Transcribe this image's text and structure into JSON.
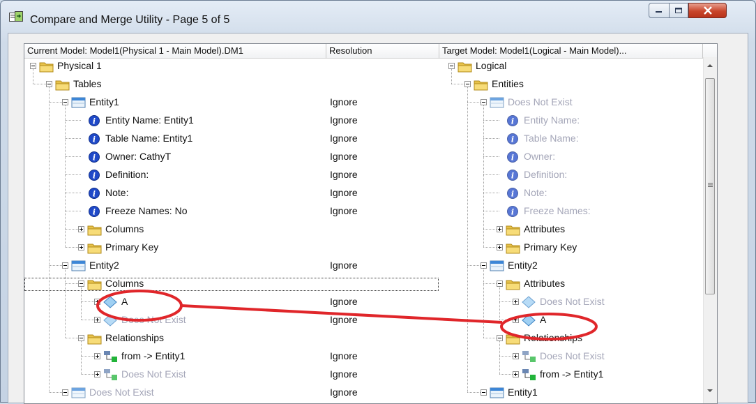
{
  "window": {
    "title": "Compare and Merge Utility  - Page 5 of 5"
  },
  "headers": {
    "current": "Current Model: Model1(Physical 1 - Main Model).DM1",
    "resolution": "Resolution",
    "target": "Target Model: Model1(Logical - Main Model)..."
  },
  "left_tree": [
    {
      "label": "Physical 1",
      "icon": "folder-icon",
      "exp": "minus",
      "level": 0,
      "res": ""
    },
    {
      "label": "Tables",
      "icon": "folder-icon",
      "exp": "minus",
      "level": 1,
      "res": ""
    },
    {
      "label": "Entity1",
      "icon": "table-icon",
      "exp": "minus",
      "level": 2,
      "res": "Ignore"
    },
    {
      "label": "Entity Name: Entity1",
      "icon": "info-icon",
      "exp": "",
      "level": 3,
      "res": "Ignore"
    },
    {
      "label": "Table Name: Entity1",
      "icon": "info-icon",
      "exp": "",
      "level": 3,
      "res": "Ignore"
    },
    {
      "label": "Owner: CathyT",
      "icon": "info-icon",
      "exp": "",
      "level": 3,
      "res": "Ignore"
    },
    {
      "label": "Definition:",
      "icon": "info-icon",
      "exp": "",
      "level": 3,
      "res": "Ignore"
    },
    {
      "label": "Note:",
      "icon": "info-icon",
      "exp": "",
      "level": 3,
      "res": "Ignore"
    },
    {
      "label": "Freeze Names: No",
      "icon": "info-icon",
      "exp": "",
      "level": 3,
      "res": "Ignore"
    },
    {
      "label": "Columns",
      "icon": "folder-icon",
      "exp": "plus",
      "level": 3,
      "res": ""
    },
    {
      "label": "Primary Key",
      "icon": "folder-icon",
      "exp": "plus",
      "level": 3,
      "res": ""
    },
    {
      "label": "Entity2",
      "icon": "table-icon",
      "exp": "minus",
      "level": 2,
      "res": "Ignore"
    },
    {
      "label": "Columns",
      "icon": "folder-icon",
      "exp": "minus",
      "level": 3,
      "res": "",
      "selected": true
    },
    {
      "label": "A",
      "icon": "diamond-icon",
      "exp": "plus",
      "level": 4,
      "res": "Ignore"
    },
    {
      "label": "Does Not Exist",
      "icon": "diamond-icon",
      "exp": "plus",
      "level": 4,
      "res": "Ignore",
      "dim": true
    },
    {
      "label": "Relationships",
      "icon": "folder-icon",
      "exp": "minus",
      "level": 3,
      "res": ""
    },
    {
      "label": "from -> Entity1",
      "icon": "relationship-icon",
      "exp": "plus",
      "level": 4,
      "res": "Ignore"
    },
    {
      "label": "Does Not Exist",
      "icon": "relationship-icon",
      "exp": "plus",
      "level": 4,
      "res": "Ignore",
      "dim": true
    },
    {
      "label": "Does Not Exist",
      "icon": "table-icon",
      "exp": "minus",
      "level": 2,
      "res": "Ignore",
      "dim": true
    }
  ],
  "right_tree": [
    {
      "label": "Logical",
      "icon": "folder-icon",
      "exp": "minus",
      "level": 0
    },
    {
      "label": "Entities",
      "icon": "folder-icon",
      "exp": "minus",
      "level": 1
    },
    {
      "label": "Does Not Exist",
      "icon": "table-icon",
      "exp": "minus",
      "level": 2,
      "dim": true
    },
    {
      "label": "Entity Name:",
      "icon": "info-icon",
      "exp": "",
      "level": 3,
      "dim": true
    },
    {
      "label": "Table Name:",
      "icon": "info-icon",
      "exp": "",
      "level": 3,
      "dim": true
    },
    {
      "label": "Owner:",
      "icon": "info-icon",
      "exp": "",
      "level": 3,
      "dim": true
    },
    {
      "label": "Definition:",
      "icon": "info-icon",
      "exp": "",
      "level": 3,
      "dim": true
    },
    {
      "label": "Note:",
      "icon": "info-icon",
      "exp": "",
      "level": 3,
      "dim": true
    },
    {
      "label": "Freeze Names:",
      "icon": "info-icon",
      "exp": "",
      "level": 3,
      "dim": true
    },
    {
      "label": "Attributes",
      "icon": "folder-icon",
      "exp": "plus",
      "level": 3
    },
    {
      "label": "Primary Key",
      "icon": "folder-icon",
      "exp": "plus",
      "level": 3
    },
    {
      "label": "Entity2",
      "icon": "table-icon",
      "exp": "minus",
      "level": 2
    },
    {
      "label": "Attributes",
      "icon": "folder-icon",
      "exp": "minus",
      "level": 3
    },
    {
      "label": "Does Not Exist",
      "icon": "diamond-icon",
      "exp": "plus",
      "level": 4,
      "dim": true
    },
    {
      "label": "A",
      "icon": "diamond-icon",
      "exp": "plus",
      "level": 4
    },
    {
      "label": "Relationships",
      "icon": "folder-icon",
      "exp": "minus",
      "level": 3
    },
    {
      "label": "Does Not Exist",
      "icon": "relationship-icon",
      "exp": "plus",
      "level": 4,
      "dim": true
    },
    {
      "label": "from -> Entity1",
      "icon": "relationship-icon",
      "exp": "plus",
      "level": 4
    },
    {
      "label": "Entity1",
      "icon": "table-icon",
      "exp": "minus",
      "level": 2
    }
  ],
  "annotation": {
    "color": "#e0262a"
  }
}
